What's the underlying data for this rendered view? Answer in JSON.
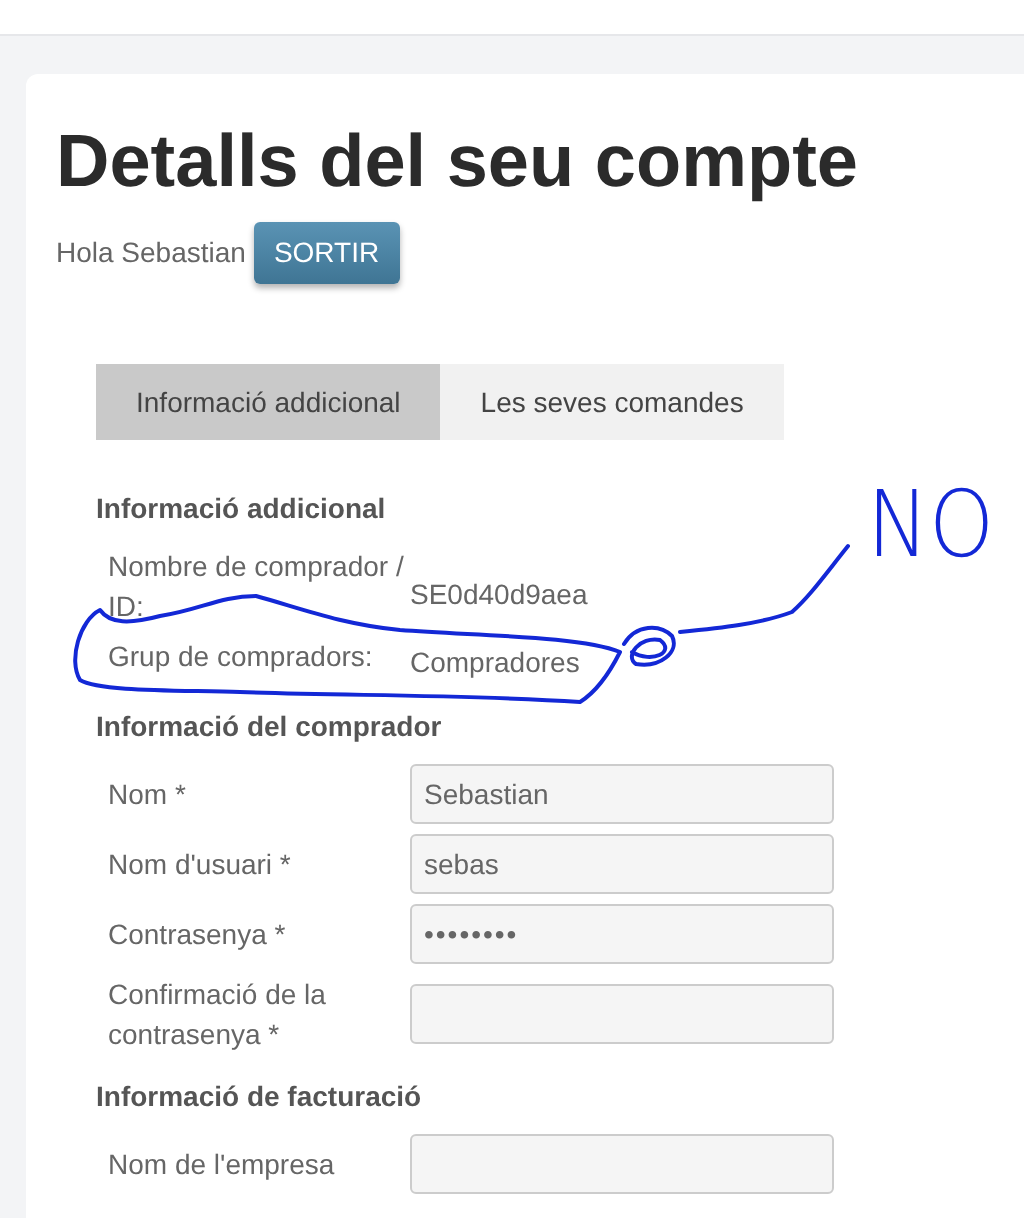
{
  "title": "Detalls del seu compte",
  "greeting": "Hola Sebastian",
  "logout_button": "SORTIR",
  "tabs": [
    {
      "label": "Informació addicional",
      "selected": true
    },
    {
      "label": "Les seves comandes",
      "selected": false
    }
  ],
  "sections": [
    {
      "heading": "Informació addicional",
      "fields": [
        {
          "kind": "static",
          "label": "Nombre de comprador / ID:",
          "value": "SE0d40d9aea"
        },
        {
          "kind": "static",
          "label": "Grup de compradors:",
          "value": "Compradores"
        }
      ]
    },
    {
      "heading": "Informació del comprador",
      "fields": [
        {
          "kind": "input",
          "label": "Nom *",
          "value": "Sebastian"
        },
        {
          "kind": "input",
          "label": "Nom d'usuari *",
          "value": "sebas"
        },
        {
          "kind": "password",
          "label": "Contrasenya *",
          "value": "••••••••"
        },
        {
          "kind": "input",
          "label": "Confirmació de la contrasenya *"
        }
      ]
    },
    {
      "heading": "Informació de facturació",
      "fields": [
        {
          "kind": "input",
          "label": "Nom de l'empresa"
        }
      ]
    }
  ],
  "annotation": {
    "text": "NO"
  }
}
